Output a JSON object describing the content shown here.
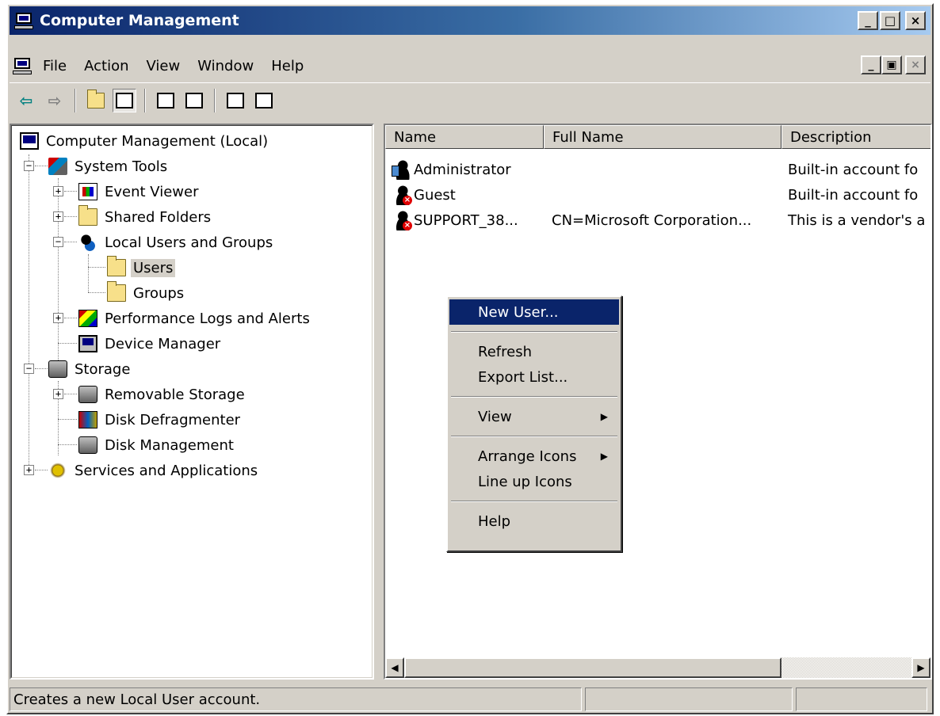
{
  "window": {
    "title": "Computer Management"
  },
  "caption_buttons": {
    "minimize": "_",
    "maximize": "□",
    "close": "×"
  },
  "menubar": {
    "items": [
      "File",
      "Action",
      "View",
      "Window",
      "Help"
    ]
  },
  "mdi_buttons": {
    "minimize": "_",
    "restore": "▣",
    "close": "×"
  },
  "toolbar": {
    "back": "⇦",
    "forward": "⇨"
  },
  "tree": {
    "root": "Computer Management (Local)",
    "system_tools": "System Tools",
    "event_viewer": "Event Viewer",
    "shared_folders": "Shared Folders",
    "local_users": "Local Users and Groups",
    "users": "Users",
    "groups": "Groups",
    "performance": "Performance Logs and Alerts",
    "device_manager": "Device Manager",
    "storage": "Storage",
    "removable_storage": "Removable Storage",
    "disk_defrag": "Disk Defragmenter",
    "disk_management": "Disk Management",
    "services": "Services and Applications",
    "expand": "+",
    "collapse": "−"
  },
  "list": {
    "columns": [
      "Name",
      "Full Name",
      "Description"
    ],
    "rows": [
      {
        "name": "Administrator",
        "full_name": "",
        "description": "Built-in account fo"
      },
      {
        "name": "Guest",
        "full_name": "",
        "description": "Built-in account fo"
      },
      {
        "name": "SUPPORT_38...",
        "full_name": "CN=Microsoft Corporation...",
        "description": "This is a vendor's a"
      }
    ],
    "scroll_left": "◀",
    "scroll_right": "▶"
  },
  "context_menu": {
    "new_user": "New User...",
    "refresh": "Refresh",
    "export_list": "Export List...",
    "view": "View",
    "arrange_icons": "Arrange Icons",
    "line_up_icons": "Line up Icons",
    "help": "Help",
    "submenu_arrow": "▶"
  },
  "status": {
    "text": "Creates a new Local User account."
  }
}
